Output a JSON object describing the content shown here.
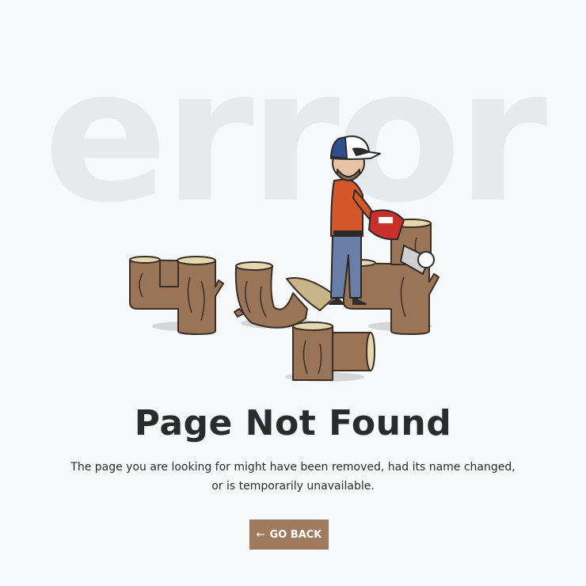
{
  "background_word": "error",
  "illustration": {
    "icon": "lumberjack-404-logs-illustration",
    "digits_shown": "404"
  },
  "title": "Page Not Found",
  "message": {
    "line1": "The page you are looking for might have been removed, had its name changed,",
    "line2": "or is temporarily unavailable."
  },
  "go_back": {
    "icon": "arrow-left-icon",
    "arrow": "←",
    "label": "GO BACK"
  },
  "colors": {
    "background": "#f7f8fa",
    "watermark": "#e8e9eb",
    "button": "#a07a5e",
    "text": "#2b2b2e",
    "wood": "#9a7456",
    "shirt": "#d4582a"
  }
}
